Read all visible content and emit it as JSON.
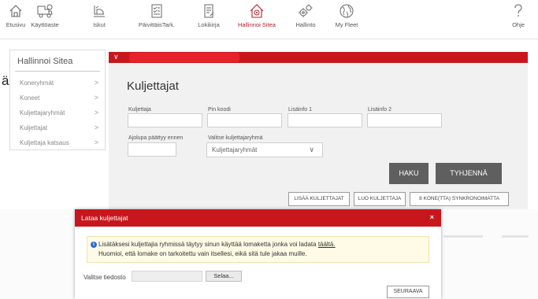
{
  "nav": {
    "items": [
      {
        "label": "Etusivu",
        "icon": "home-icon"
      },
      {
        "label": "Käyttöaste",
        "icon": "truck-icon"
      },
      {
        "label": "Iskut",
        "icon": "grapple-icon"
      },
      {
        "label": "PäivittäisTark.",
        "icon": "checklist-icon"
      },
      {
        "label": "Lokikirja",
        "icon": "logbook-icon"
      },
      {
        "label": "Hallinnoi Sitea",
        "icon": "manage-site-icon"
      },
      {
        "label": "Hallinto",
        "icon": "gears-icon"
      },
      {
        "label": "My Fleet",
        "icon": "globe-icon"
      }
    ],
    "help_label": "Ohje",
    "active_color": "#b3202c"
  },
  "sidebar": {
    "title": "Hallinnoi Sitea",
    "items": [
      {
        "label": "Koneryhmät"
      },
      {
        "label": "Koneet"
      },
      {
        "label": "Kuljettajaryhmät"
      },
      {
        "label": "Kuljettajat"
      },
      {
        "label": "Kuljettaja katsaus"
      }
    ],
    "stray_text": "ä"
  },
  "main": {
    "title": "Kuljettajat",
    "fields": {
      "driver": "Kuljettaja",
      "pin": "Pin koodi",
      "info1": "Lisäinfo 1",
      "info2": "Lisäinfo 2",
      "expired": "Ajolupa päättyy ennen",
      "group": "Valitse kuljettajaryhmä",
      "group_value": "Kuljettajaryhmät"
    },
    "buttons": {
      "search": "HAKU",
      "clear": "TYHJENNÄ",
      "add_drivers": "LISÄÄ KULJETTAJAT",
      "create_driver": "LUO KULJETTAJA",
      "sync": "8 KONE(TTA) SYNKRONOIMATTA"
    },
    "brand_color": "#c8161d"
  },
  "modal": {
    "title": "Lataa kuljettajat",
    "close": "×",
    "info_line1": "Lisätäksesi kuljettajia ryhmissä täytyy sinun käyttää lomaketta jonka voi ladata",
    "info_link": "täältä.",
    "info_line2": "Huomioi, että lomake on tarkoitettu vain itsellesi, eikä sitä tule jakaa muille.",
    "file_label": "Valitse tiedosto",
    "browse": "Selaa...",
    "next": "SEURAAVA"
  }
}
